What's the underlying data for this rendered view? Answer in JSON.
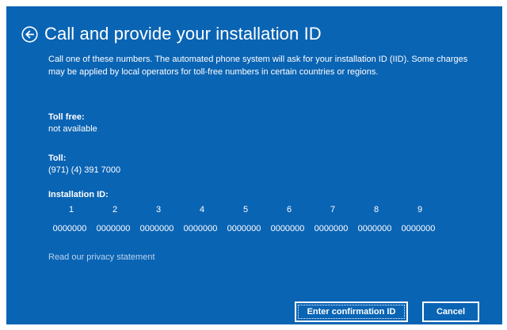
{
  "header": {
    "back_icon": "back-arrow-circle-icon",
    "title": "Call and provide your installation ID"
  },
  "description": "Call one of these numbers. The automated phone system will ask for your installation ID (IID). Some charges may be applied by local operators for toll-free numbers in certain countries or regions.",
  "toll_free": {
    "label": "Toll free:",
    "value": "not available"
  },
  "toll": {
    "label": "Toll:",
    "value": "(971) (4) 391 7000"
  },
  "installation_id": {
    "label": "Installation ID:",
    "groups": [
      {
        "number": "1",
        "value": "0000000"
      },
      {
        "number": "2",
        "value": "0000000"
      },
      {
        "number": "3",
        "value": "0000000"
      },
      {
        "number": "4",
        "value": "0000000"
      },
      {
        "number": "5",
        "value": "0000000"
      },
      {
        "number": "6",
        "value": "0000000"
      },
      {
        "number": "7",
        "value": "0000000"
      },
      {
        "number": "8",
        "value": "0000000"
      },
      {
        "number": "9",
        "value": "0000000"
      }
    ]
  },
  "privacy_link": "Read our privacy statement",
  "buttons": {
    "enter_confirmation": "Enter confirmation ID",
    "cancel": "Cancel"
  },
  "colors": {
    "background": "#0a64b4",
    "text": "#ffffff",
    "link": "#b9d3ee"
  }
}
